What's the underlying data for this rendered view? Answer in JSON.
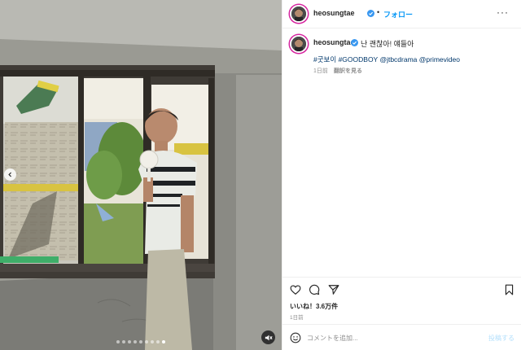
{
  "post": {
    "username": "heosungtae",
    "separator": "•",
    "follow_label": "フォロー",
    "more_label": "···",
    "caption_text": "난 괜찮아! 얘들아",
    "tags": [
      "#굿보이",
      "#GOODBOY",
      "@jtbcdrama",
      "@primevideo"
    ],
    "time_ago": "1日前",
    "translate_label": "翻訳を見る",
    "likes_label": "いいね！3.6万件",
    "posted_ago": "1日前",
    "comment_placeholder": "コメントを追加...",
    "post_label": "投稿する"
  },
  "media": {
    "carousel_total": 9,
    "carousel_active_index": 8,
    "muted": true
  },
  "icons": {
    "like": "heart-icon",
    "comment": "comment-icon",
    "share": "send-icon",
    "save": "bookmark-icon",
    "emoji": "emoji-icon",
    "verified": "verified-badge-icon",
    "mute": "muted-speaker-icon",
    "prev": "chevron-left-icon"
  },
  "colors": {
    "accent": "#0095f6",
    "link": "#00376b",
    "muted_text": "#8e8e8e",
    "verified": "#3897f0",
    "story_ring": "#d6249f"
  }
}
